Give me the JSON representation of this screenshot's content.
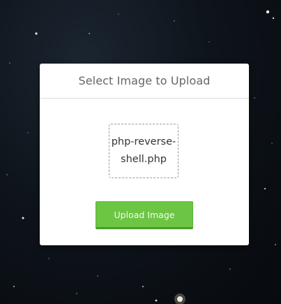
{
  "upload_card": {
    "title": "Select Image to Upload",
    "selected_file": "php-reverse-shell.php",
    "upload_button_label": "Upload Image"
  },
  "colors": {
    "button_bg": "#6cc644",
    "title_text": "#666666",
    "background": "#0e141b"
  },
  "icons": []
}
